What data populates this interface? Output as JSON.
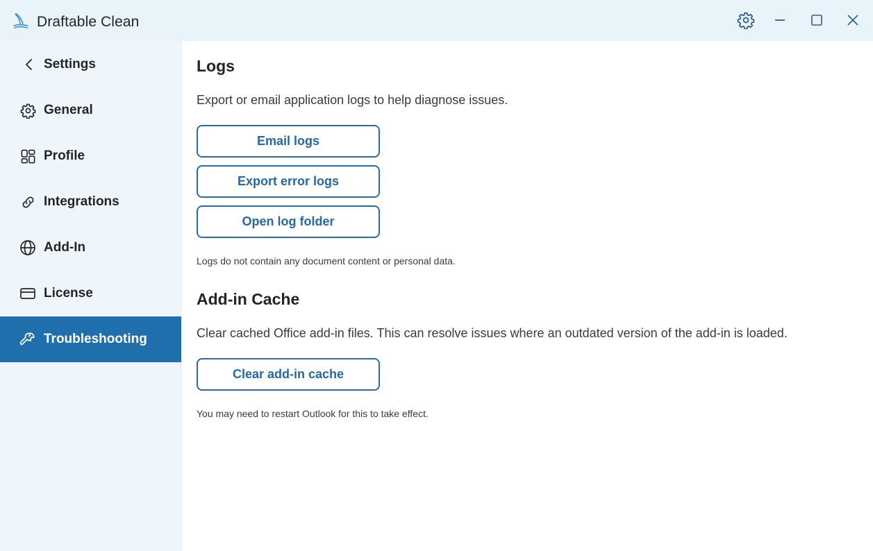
{
  "window": {
    "title": "Draftable Clean",
    "logo_icon": "draftable-wave-icon",
    "controls": [
      "settings-icon",
      "minimize-icon",
      "maximize-icon",
      "close-icon"
    ]
  },
  "sidebar": {
    "back_label": "Settings",
    "items": [
      {
        "label": "General",
        "icon": "gear-icon"
      },
      {
        "label": "Profile",
        "icon": "grid-icon"
      },
      {
        "label": "Integrations",
        "icon": "link-icon"
      },
      {
        "label": "Add-In",
        "icon": "globe-icon"
      },
      {
        "label": "License",
        "icon": "card-icon"
      },
      {
        "label": "Troubleshooting",
        "icon": "wrench-icon",
        "active": true
      }
    ]
  },
  "main": {
    "logs": {
      "heading": "Logs",
      "description": "Export or email application logs to help diagnose issues.",
      "buttons": [
        "Email logs",
        "Export error logs",
        "Open log folder"
      ],
      "note": "Logs do not contain any document content or personal data."
    },
    "cache": {
      "heading": "Add-in Cache",
      "description": "Clear cached Office add-in files. This can resolve issues where an outdated version of the add-in is loaded.",
      "button": "Clear add-in cache",
      "note": "You may need to restart Outlook for this to take effect."
    }
  },
  "colors": {
    "accent": "#1f6fad",
    "button_text": "#2568a6",
    "titlebar_bg": "#e9f3fa",
    "sidebar_bg": "#eef6fc"
  }
}
